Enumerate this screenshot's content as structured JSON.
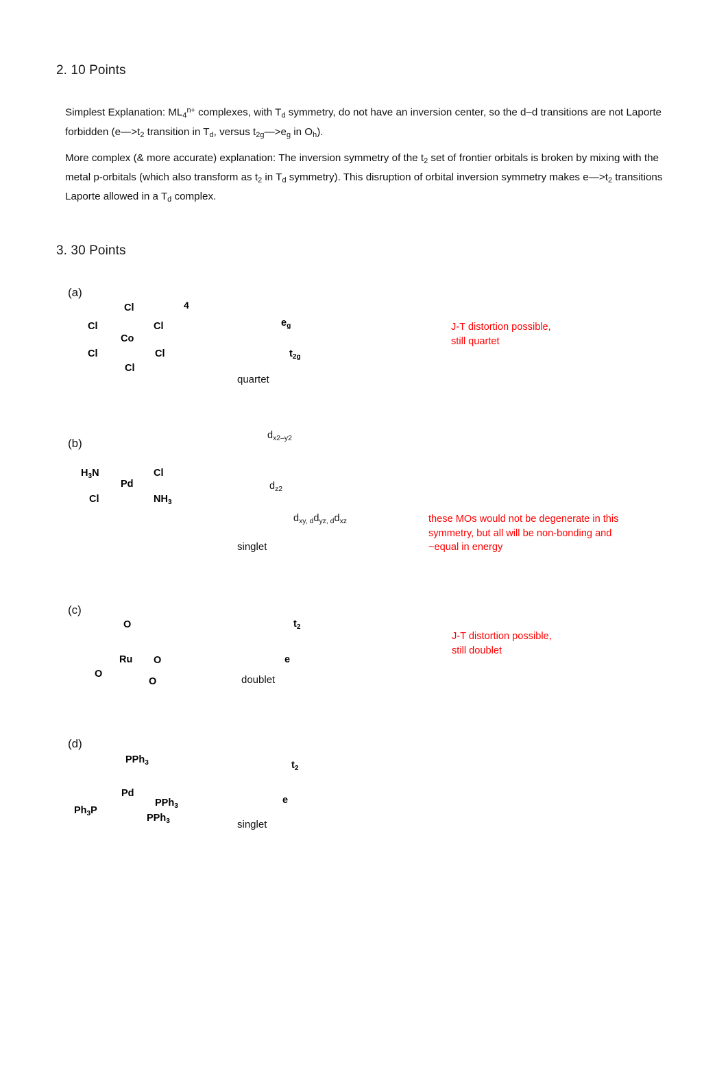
{
  "document": {
    "background_color": "#ffffff",
    "annotation_color": "#ff0000",
    "text_color": "#111111"
  },
  "section2": {
    "heading": "2. 10 Points",
    "paragraph1": {
      "part1": "Simplest Explanation: ML",
      "sub1": "4",
      "sup1": "n+",
      "part2": " complexes, with T",
      "sub2": "d",
      "part3": " symmetry, do not have an inversion center, so the d–d transitions are not Laporte forbidden (e—>t",
      "sub3": "2",
      "part4": " transition in T",
      "sub4": "d",
      "part5": ", versus t",
      "sub5": "2g",
      "part6": "—>e",
      "sub6": "g",
      "part7": " in O",
      "sub7": "h",
      "part8": ")."
    },
    "paragraph2": {
      "part1": "More complex (& more accurate) explanation: The inversion symmetry of the t",
      "sub1": "2",
      "part2": " set of frontier orbitals is broken by mixing with the metal p-orbitals (which also transform as t",
      "sub2": "2",
      "part3": " in T",
      "sub3": "d",
      "part4": " symmetry). This disruption of orbital inversion symmetry makes e—>t",
      "sub4": "2",
      "part5": " transitions Laporte allowed in a T",
      "sub5": "d",
      "part6": " complex."
    }
  },
  "section3": {
    "heading": "3. 30 Points",
    "parts": [
      {
        "label": "(a)",
        "structure": {
          "metal": "Co",
          "ligands": [
            {
              "formula": "Cl",
              "sub": ""
            },
            {
              "formula": "Cl",
              "sub": ""
            },
            {
              "formula": "Cl",
              "sub": ""
            },
            {
              "formula": "Cl",
              "sub": ""
            },
            {
              "formula": "Cl",
              "sub": ""
            },
            {
              "formula": "Cl",
              "sub": ""
            }
          ],
          "charge": "4",
          "geometry": "octahedral"
        },
        "diagram": {
          "upper_term": "e",
          "upper_sub": "g",
          "lower_term": "t",
          "lower_sub": "2g",
          "multiplicity": "quartet"
        },
        "annotation": "J-T distortion possible,\nstill quartet"
      },
      {
        "label": "(b)",
        "structure": {
          "metal": "Pd",
          "ligands": [
            {
              "formula": "H",
              "sub": "3",
              "suffix": "N"
            },
            {
              "formula": "Cl",
              "sub": ""
            },
            {
              "formula": "Cl",
              "sub": ""
            },
            {
              "formula": "NH",
              "sub": "3"
            }
          ],
          "charge": "",
          "geometry": "square planar"
        },
        "diagram": {
          "level1": "d",
          "level1_sub": "x2–y2",
          "level2": "d",
          "level2_sub": "z2",
          "level3": "d",
          "level3_sub": "xy, d",
          "level3_sub_b": "yz, d",
          "level3_sub_c": "xz",
          "multiplicity": "singlet"
        },
        "annotation": "these MOs would not be degenerate in this\nsymmetry, but all will be non-bonding and\n~equal in energy"
      },
      {
        "label": "(c)",
        "structure": {
          "metal": "Ru",
          "ligands": [
            {
              "formula": "O",
              "sub": ""
            },
            {
              "formula": "O",
              "sub": ""
            },
            {
              "formula": "O",
              "sub": ""
            },
            {
              "formula": "O",
              "sub": ""
            }
          ],
          "charge": "",
          "geometry": "tetrahedral"
        },
        "diagram": {
          "upper_term": "t",
          "upper_sub": "2",
          "lower_term": "e",
          "lower_sub": "",
          "multiplicity": "doublet"
        },
        "annotation": "J-T distortion possible,\nstill doublet"
      },
      {
        "label": "(d)",
        "structure": {
          "metal": "Pd",
          "ligands": [
            {
              "formula": "PPh",
              "sub": "3"
            },
            {
              "formula": "Ph",
              "sub": "3",
              "suffix": "P"
            },
            {
              "formula": "PPh",
              "sub": "3"
            },
            {
              "formula": "PPh",
              "sub": "3"
            }
          ],
          "charge": "",
          "geometry": "tetrahedral"
        },
        "diagram": {
          "upper_term": "t",
          "upper_sub": "2",
          "lower_term": "e",
          "lower_sub": "",
          "multiplicity": "singlet"
        },
        "annotation": ""
      }
    ]
  },
  "atoms": {
    "a_cl_top": "Cl",
    "a_cl_upleft": "Cl",
    "a_cl_upright": "Cl",
    "a_co": "Co",
    "a_cl_lowleft": "Cl",
    "a_cl_lowright": "Cl",
    "a_cl_bottom": "Cl",
    "a_charge": "4",
    "b_h3n": "H",
    "b_h3n_sub": "3",
    "b_h3n_suffix": "N",
    "b_cl_right": "Cl",
    "b_pd": "Pd",
    "b_cl_left": "Cl",
    "b_nh3": "NH",
    "b_nh3_sub": "3",
    "c_o_top": "O",
    "c_ru": "Ru",
    "c_o_right": "O",
    "c_o_left": "O",
    "c_o_bottom": "O",
    "d_pph3_top": "PPh",
    "d_pph3_top_sub": "3",
    "d_pd": "Pd",
    "d_ph3p": "Ph",
    "d_ph3p_sub": "3",
    "d_ph3p_suffix": "P",
    "d_pph3_mid": "PPh",
    "d_pph3_mid_sub": "3",
    "d_pph3_low": "PPh",
    "d_pph3_low_sub": "3"
  },
  "annotations": {
    "a_line1": "J-T distortion possible,",
    "a_line2": "still quartet",
    "b_line1": "these MOs would not be degenerate in this",
    "b_line2": "symmetry, but all will be non-bonding and",
    "b_line3": "~equal in energy",
    "c_line1": "J-T distortion possible,",
    "c_line2": "still doublet"
  },
  "multiplicities": {
    "a": "quartet",
    "b": "singlet",
    "c": "doublet",
    "d": "singlet"
  }
}
